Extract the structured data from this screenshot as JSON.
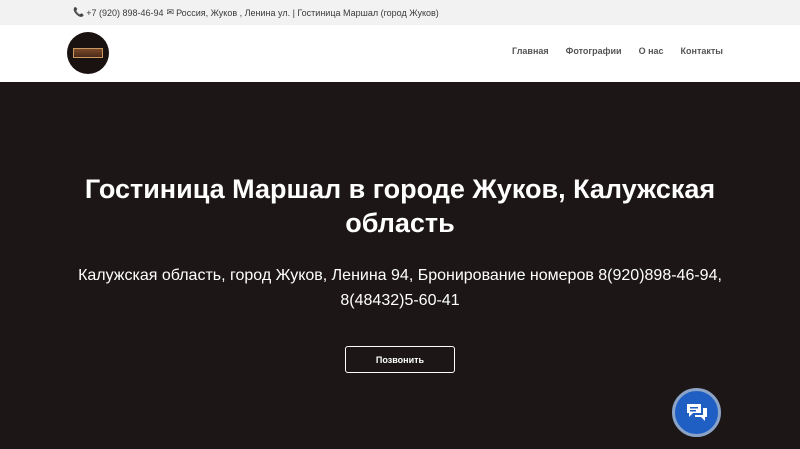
{
  "topbar": {
    "phone_icon": "phone-icon",
    "phone": "+7 (920) 898-46-94",
    "mail_icon": "envelope-icon",
    "address": "Россия, Жуков , Ленина ул. | Гостиница Маршал (город Жуков)"
  },
  "header": {
    "logo_icon": "hotel-logo",
    "nav": {
      "home": "Главная",
      "photos": "Фотографии",
      "about": "О нас",
      "contacts": "Контакты"
    }
  },
  "hero": {
    "title": "Гостиница Маршал в городе Жуков, Калужская область",
    "subtitle": "Калужская область, город Жуков, Ленина 94, Бронирование номеров 8(920)898-46-94, 8(48432)5-60-41",
    "call_button": "Позвонить"
  },
  "chat_widget": {
    "icon": "chat-icon"
  },
  "colors": {
    "hero_bg": "#1c1716",
    "chat_bg": "#1f5fc4",
    "topbar_bg": "#f2f2f2",
    "header_bg": "#ffffff"
  }
}
